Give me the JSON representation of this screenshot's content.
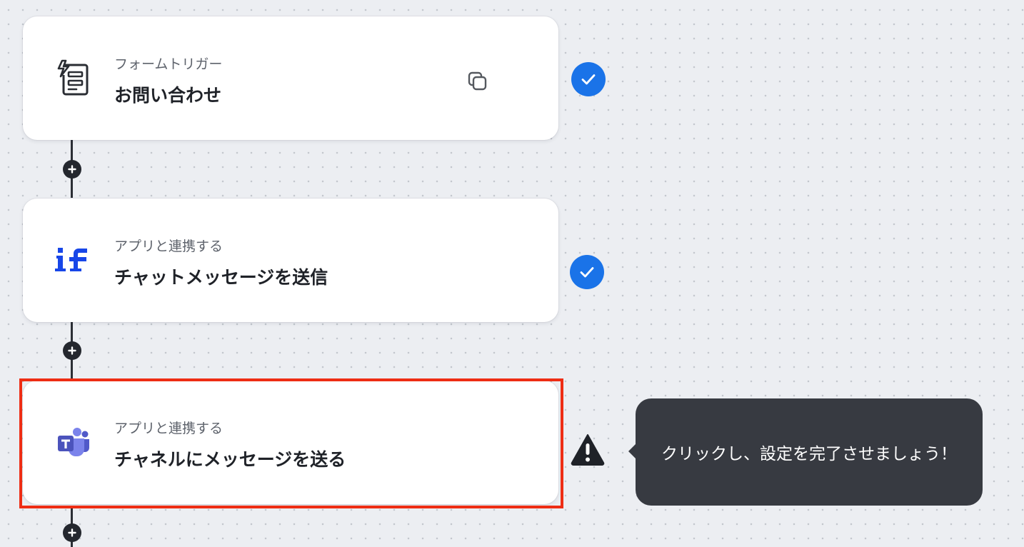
{
  "flow": {
    "steps": [
      {
        "subtitle": "フォームトリガー",
        "title": "お問い合わせ",
        "icon": "form-trigger-icon",
        "status": "complete"
      },
      {
        "subtitle": "アプリと連携する",
        "title": "チャットメッセージを送信",
        "icon": "if-app-logo",
        "logo_text": "if",
        "status": "complete"
      },
      {
        "subtitle": "アプリと連携する",
        "title": "チャネルにメッセージを送る",
        "icon": "microsoft-teams-logo",
        "logo_text": "T",
        "status": "warning"
      }
    ]
  },
  "tooltip": {
    "text": "クリックし、設定を完了させましょう！"
  },
  "colors": {
    "accent_blue": "#1a73e8",
    "highlight_red": "#ee2d14",
    "tooltip_bg": "#373a41",
    "if_logo_blue": "#1746e8",
    "teams_purple": "#5b5fc7"
  }
}
